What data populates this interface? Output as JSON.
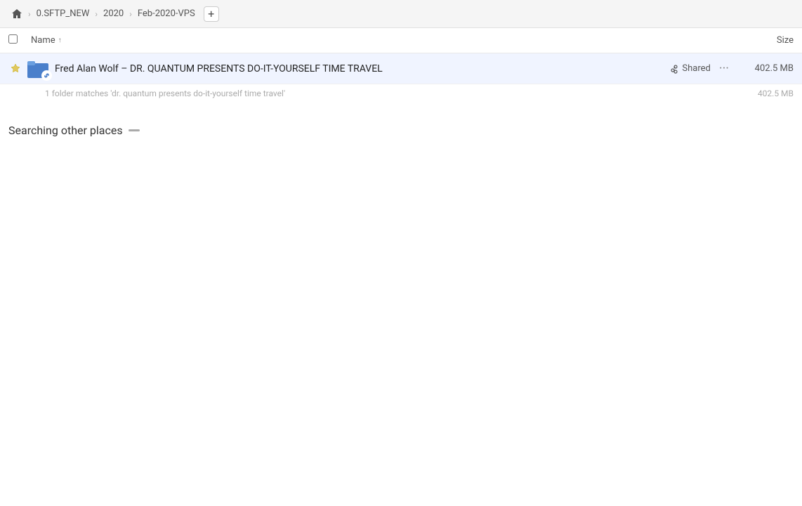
{
  "header": {
    "home_icon": "🏠",
    "breadcrumb": [
      {
        "label": "0.SFTP_NEW"
      },
      {
        "label": "2020"
      },
      {
        "label": "Feb-2020-VPS"
      }
    ],
    "add_button": "+"
  },
  "columns": {
    "name_label": "Name",
    "sort_indicator": "↑",
    "size_label": "Size"
  },
  "file_row": {
    "name": "Fred Alan Wolf – DR. QUANTUM PRESENTS DO-IT-YOURSELF TIME TRAVEL",
    "shared_label": "Shared",
    "size": "402.5 MB",
    "more_icon": "···"
  },
  "summary": {
    "text": "1 folder matches 'dr. quantum presents do-it-yourself time travel'",
    "size": "402.5 MB"
  },
  "searching": {
    "title": "Searching other places"
  }
}
